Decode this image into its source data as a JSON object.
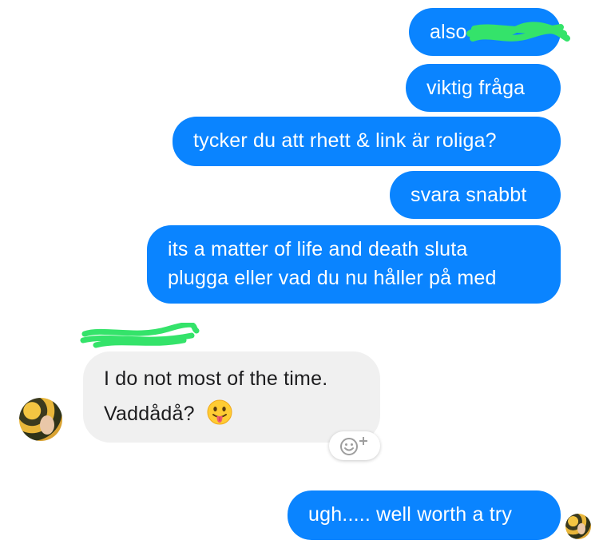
{
  "conversation": {
    "outgoing_top": [
      "also",
      "viktig fråga",
      "tycker du att rhett & link är roliga?",
      "svara snabbt"
    ],
    "outgoing_long": {
      "line1": "its a matter of life and death sluta",
      "line2": "plugga eller vad du nu håller på med"
    },
    "incoming": {
      "line1": "I do not most of the time.",
      "line2": "Vaddådå?",
      "emoji": "face-with-tongue"
    },
    "outgoing_last": "ugh..... well worth a try"
  },
  "colors": {
    "outgoing_bubble": "#0a84ff",
    "incoming_bubble": "#f0f0f0",
    "redaction": "#34e36a"
  },
  "icons": {
    "react": "add-reaction-icon",
    "avatar": "contact-avatar",
    "read_receipt": "read-receipt-avatar"
  }
}
